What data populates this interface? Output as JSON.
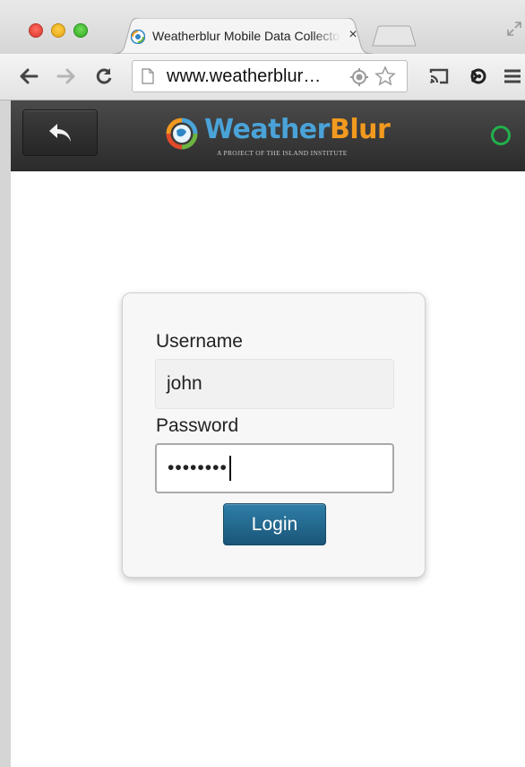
{
  "browser": {
    "tab_title": "Weatherblur Mobile Data Collector",
    "tab_close_glyph": "×",
    "url": "www.weatherblur.org",
    "url_display": "www.weatherblur…",
    "icons": [
      "close-window",
      "minimize-window",
      "maximize-window",
      "globe-favicon",
      "new-tab",
      "back-arrow",
      "forward-arrow",
      "reload",
      "page",
      "location",
      "star",
      "cast",
      "extension",
      "menu"
    ]
  },
  "app": {
    "logo_weather": "Weather",
    "logo_blur": "Blur",
    "tagline": "A PROJECT OF THE ISLAND INSTITUTE",
    "status": "connected",
    "colors": {
      "weather": "#4aa3d8",
      "blur": "#f29a1f",
      "status": "#22b14c",
      "button": "#1f6a93"
    }
  },
  "login": {
    "username_label": "Username",
    "username_value": "john",
    "password_label": "Password",
    "password_masked": "••••••••",
    "submit_label": "Login"
  }
}
